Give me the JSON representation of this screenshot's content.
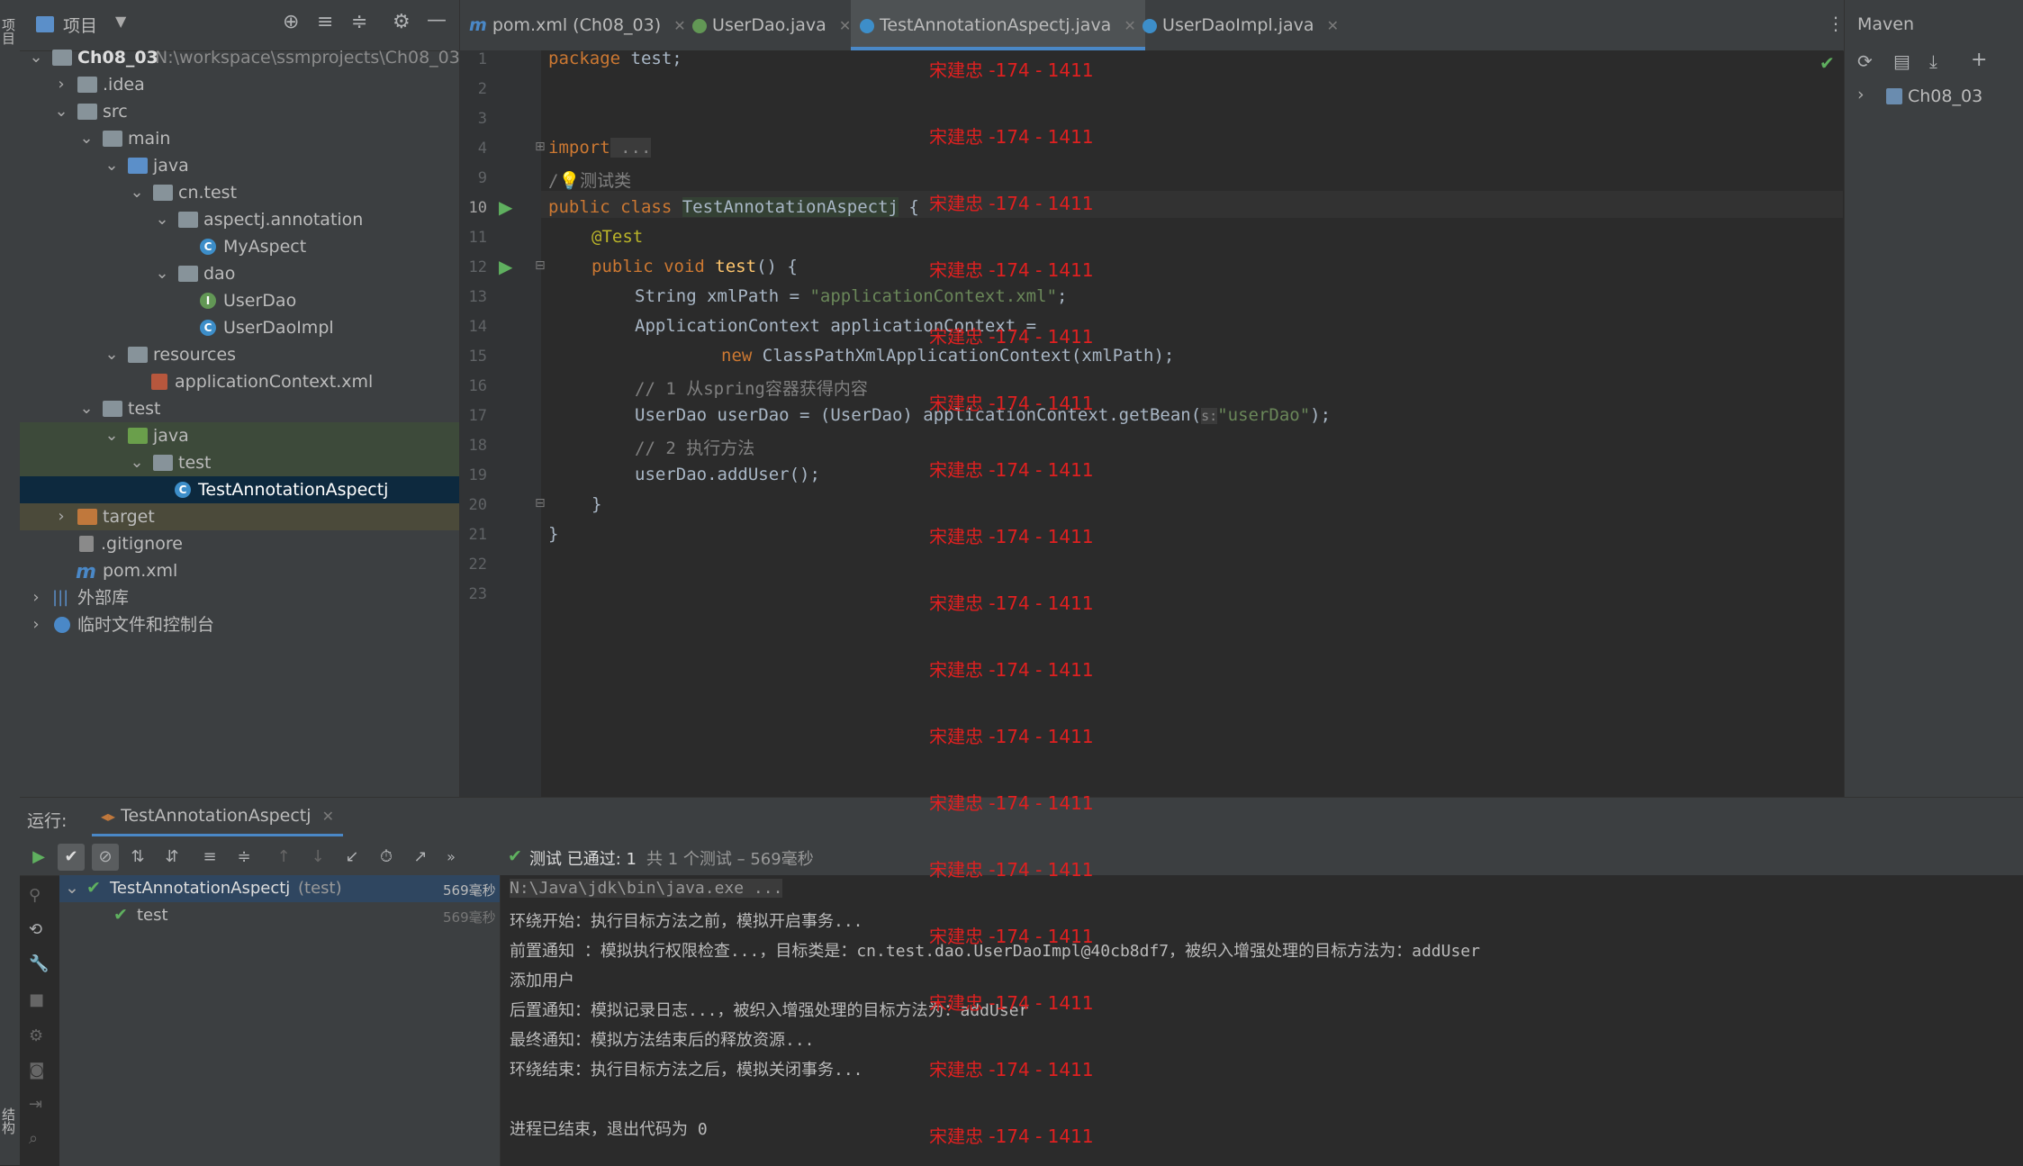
{
  "left_strip": {
    "tab_project": "项目",
    "tab_structure": "结构"
  },
  "project_panel": {
    "title": "项目",
    "tree": [
      {
        "label": "Ch08_03",
        "path": "N:\\workspace\\ssmprojects\\Ch08_03"
      },
      {
        "label": ".idea"
      },
      {
        "label": "src"
      },
      {
        "label": "main"
      },
      {
        "label": "java"
      },
      {
        "label": "cn.test"
      },
      {
        "label": "aspectj.annotation"
      },
      {
        "label": "MyAspect"
      },
      {
        "label": "dao"
      },
      {
        "label": "UserDao"
      },
      {
        "label": "UserDaoImpl"
      },
      {
        "label": "resources"
      },
      {
        "label": "applicationContext.xml"
      },
      {
        "label": "test"
      },
      {
        "label": "java"
      },
      {
        "label": "test"
      },
      {
        "label": "TestAnnotationAspectj"
      },
      {
        "label": "target"
      },
      {
        "label": ".gitignore"
      },
      {
        "label": "pom.xml"
      },
      {
        "label": "外部库"
      },
      {
        "label": "临时文件和控制台"
      }
    ]
  },
  "tabs": [
    {
      "label": "pom.xml (Ch08_03)",
      "icon": "maven-icon"
    },
    {
      "label": "UserDao.java",
      "icon": "interface-icon"
    },
    {
      "label": "TestAnnotationAspectj.java",
      "icon": "class-icon",
      "active": true
    },
    {
      "label": "UserDaoImpl.java",
      "icon": "class-icon"
    }
  ],
  "editor": {
    "line_numbers": [
      "1",
      "2",
      "3",
      "4",
      "9",
      "10",
      "11",
      "12",
      "13",
      "14",
      "15",
      "16",
      "17",
      "18",
      "19",
      "20",
      "21",
      "22",
      "23"
    ],
    "lines": {
      "l1_kw": "package",
      "l1_rest": " test;",
      "l4_kw": "import",
      "l4_rest": " ...",
      "l9_cmt": "/",
      "l9_cmt2": "测试类",
      "l10_kw": "public class",
      "l10_name": "TestAnnotationAspectj",
      "l10_rest": " {",
      "l11_ann": "@Test",
      "l12_kw": "public void",
      "l12_fn": "test",
      "l12_rest": "() {",
      "l13_a": "String xmlPath = ",
      "l13_str": "\"applicationContext.xml\"",
      "l13_b": ";",
      "l14": "ApplicationContext applicationContext =",
      "l15_kw": "new",
      "l15_rest": " ClassPathXmlApplicationContext(xmlPath);",
      "l16_cmt": "// 1 从spring容器获得内容",
      "l17_a": "UserDao userDao = (UserDao) applicationContext.getBean(",
      "l17_hint": "s:",
      "l17_str": "\"userDao\"",
      "l17_b": ");",
      "l18_cmt": "// 2 执行方法",
      "l19": "userDao.addUser();",
      "l20": "}",
      "l21": "}"
    }
  },
  "watermark": "宋建忠 -174 - 1411",
  "maven": {
    "title": "Maven",
    "project": "Ch08_03"
  },
  "run": {
    "label": "运行:",
    "tab": "TestAnnotationAspectj",
    "status_bold": "测试 已通过: 1",
    "status_rest": "共 1 个测试 – 569毫秒",
    "tree": [
      {
        "name": "TestAnnotationAspectj",
        "suffix": "(test)",
        "time": "569毫秒"
      },
      {
        "name": "test",
        "time": "569毫秒"
      }
    ],
    "console": [
      "N:\\Java\\jdk\\bin\\java.exe ...",
      "环绕开始：执行目标方法之前，模拟开启事务...",
      "前置通知 ：模拟执行权限检查...，目标类是：cn.test.dao.UserDaoImpl@40cb8df7，被织入增强处理的目标方法为：addUser",
      "添加用户",
      "后置通知：模拟记录日志...，被织入增强处理的目标方法为：addUser",
      "最终通知：模拟方法结束后的释放资源...",
      "环绕结束：执行目标方法之后，模拟关闭事务...",
      "",
      "进程已结束，退出代码为 0"
    ]
  }
}
